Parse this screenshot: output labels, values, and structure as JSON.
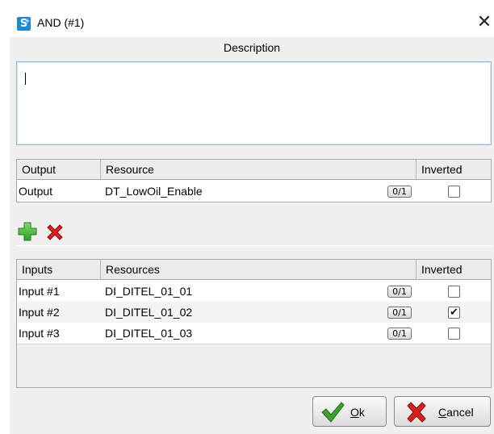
{
  "window": {
    "title": "AND (#1)",
    "app_icon_glyph": "S",
    "close_glyph": "✕"
  },
  "description": {
    "label": "Description",
    "value": ""
  },
  "output_table": {
    "columns": [
      "Output",
      "Resource",
      "Inverted"
    ],
    "rows": [
      {
        "name": "Output",
        "resource": "DT_LowOil_Enable",
        "badge": "0/1",
        "inverted": false
      }
    ]
  },
  "toolbar": {
    "add_icon": "plus-icon",
    "remove_icon": "delete-x-icon"
  },
  "inputs_table": {
    "columns": [
      "Inputs",
      "Resources",
      "Inverted"
    ],
    "rows": [
      {
        "name": "Input #1",
        "resource": "DI_DITEL_01_01",
        "badge": "0/1",
        "inverted": false
      },
      {
        "name": "Input #2",
        "resource": "DI_DITEL_01_02",
        "badge": "0/1",
        "inverted": true
      },
      {
        "name": "Input #3",
        "resource": "DI_DITEL_01_03",
        "badge": "0/1",
        "inverted": false
      }
    ]
  },
  "buttons": {
    "ok_label": "Ok",
    "ok_mnemonic": "O",
    "cancel_label": "Cancel",
    "cancel_mnemonic": "C"
  },
  "colors": {
    "accent": "#1e88d8",
    "ok_green": "#3aa32d",
    "cancel_red": "#d62020",
    "add_green": "#3cb43c"
  }
}
